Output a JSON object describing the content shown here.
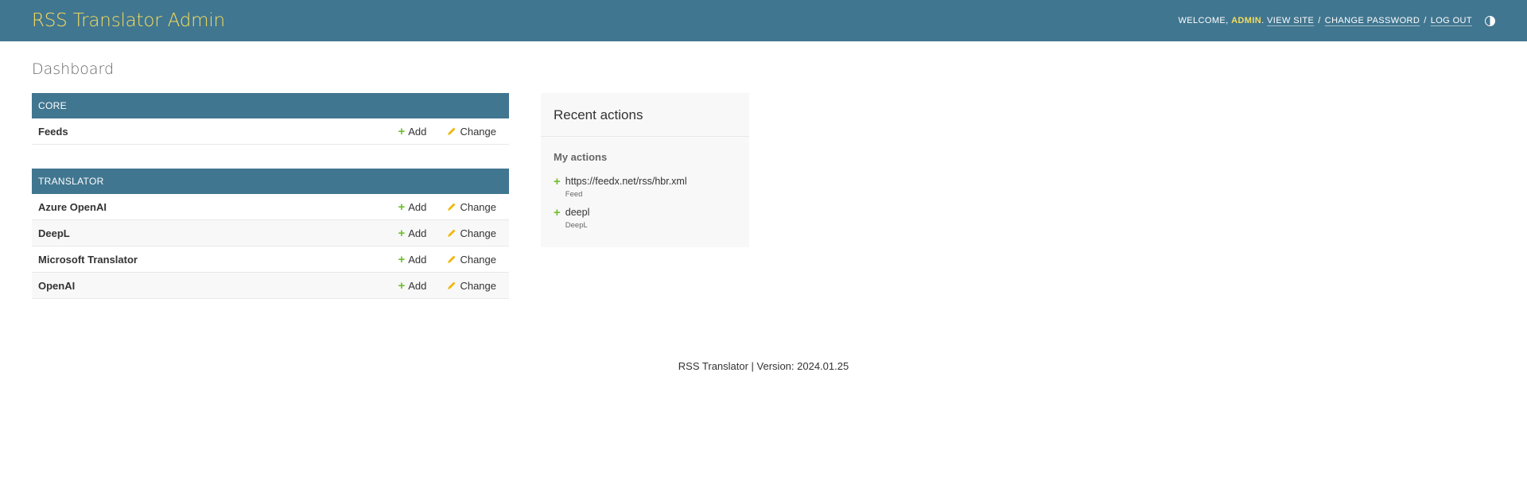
{
  "header": {
    "branding": "RSS Translator Admin",
    "welcome": "WELCOME,",
    "user": "ADMIN",
    "view_site": "VIEW SITE",
    "change_password": "CHANGE PASSWORD",
    "log_out": "LOG OUT",
    "theme_icon": "theme-toggle-icon"
  },
  "page": {
    "title": "Dashboard"
  },
  "modules": [
    {
      "caption": "CORE",
      "models": [
        {
          "name": "Feeds",
          "add": "Add",
          "change": "Change"
        }
      ]
    },
    {
      "caption": "TRANSLATOR",
      "models": [
        {
          "name": "Azure OpenAI",
          "add": "Add",
          "change": "Change"
        },
        {
          "name": "DeepL",
          "add": "Add",
          "change": "Change"
        },
        {
          "name": "Microsoft Translator",
          "add": "Add",
          "change": "Change"
        },
        {
          "name": "OpenAI",
          "add": "Add",
          "change": "Change"
        }
      ]
    }
  ],
  "recent": {
    "title": "Recent actions",
    "subtitle": "My actions",
    "items": [
      {
        "text": "https://feedx.net/rss/hbr.xml",
        "type": "Feed"
      },
      {
        "text": "deepl",
        "type": "DeepL"
      }
    ]
  },
  "footer": {
    "text": "RSS Translator | Version: 2024.01.25"
  },
  "colors": {
    "header_bg": "#417690",
    "brand": "#f5dd5d",
    "add_icon": "#70bf2b",
    "change_icon": "#efb80b"
  }
}
